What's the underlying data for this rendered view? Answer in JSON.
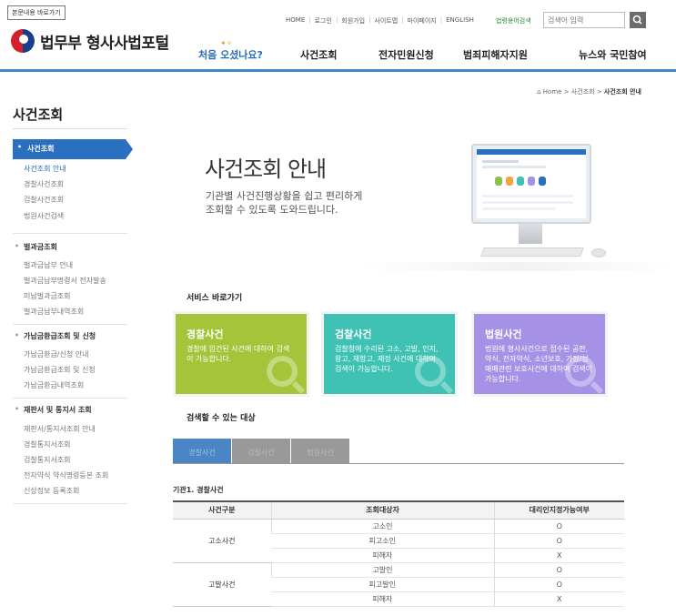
{
  "header": {
    "skip_link": "본문내용 바로가기",
    "utils": [
      "HOME",
      "로그인",
      "회원가입",
      "사이트맵",
      "마이페이지",
      "ENGLISH"
    ],
    "legal_terms": "법령용어검색",
    "search_placeholder": "검색어 입력",
    "logo_text": "법무부 형사사법포털"
  },
  "gnb": {
    "first": "처음 오셨나요?",
    "items": [
      "사건조회",
      "전자민원신청",
      "범죄피해자지원",
      "뉴스와 국민참여"
    ]
  },
  "breadcrumb": {
    "home": "Home",
    "mid": "사건조회",
    "current": "사건조회 안내",
    "sep": ">"
  },
  "sidebar": {
    "title": "사건조회",
    "groups": [
      {
        "label": "사건조회",
        "items": [
          "사건조회 안내",
          "경찰사건조회",
          "검찰사건조회",
          "법원사건검색"
        ]
      },
      {
        "label": "벌과금조회",
        "items": [
          "벌과금납부 안내",
          "벌과금납부명령서 전자발송",
          "미납벌과금조회",
          "벌과금납부내역조회"
        ]
      },
      {
        "label": "가납금환급조회 및 신청",
        "items": [
          "가납금환급/신청 안내",
          "가납금환급조회 및 신청",
          "가납금환급내역조회"
        ]
      },
      {
        "label": "재판서 및 통지서 조회",
        "items": [
          "재판서/통지서조회 안내",
          "경찰통지서조회",
          "검찰통지서조회",
          "전자약식 약식명령등본 조회",
          "신상정보 등록조회"
        ]
      }
    ]
  },
  "hero": {
    "title": "사건조회 안내",
    "desc_line1": "기관별 사건진행상황을 쉽고 편리하게",
    "desc_line2": "조회할 수 있도록 도와드립니다."
  },
  "services": {
    "title": "서비스 바로가기",
    "cards": [
      {
        "title": "경찰사건",
        "desc": "경찰에 입건된 사건에 대하여 검색이 가능합니다.",
        "color": "#a6c43a"
      },
      {
        "title": "검찰사건",
        "desc": "검찰청에 수리된 고소, 고발, 인지, 왕고, 재항고, 재정 사건에 대하여 검색이 가능합니다.",
        "color": "#3fc2b3"
      },
      {
        "title": "법원사건",
        "desc": "법원에 형사사건으로 접수된 공판, 약식, 전자약식, 소년보호, 가정/성매매관련 보호사건에 대하여 검색이 가능합니다.",
        "color": "#a592e6"
      }
    ]
  },
  "targets": {
    "title": "검색할 수 있는 대상",
    "tabs": [
      "경찰사건",
      "검찰사건",
      "법원사건"
    ],
    "active_tab": 0,
    "institution_label": "기관1. 경찰사건",
    "table": {
      "headers": [
        "사건구분",
        "조회대상자",
        "대리인지정가능여부"
      ],
      "groups": [
        {
          "name": "고소사건",
          "rows": [
            [
              "고소인",
              "O"
            ],
            [
              "피고소인",
              "O"
            ],
            [
              "피해자",
              "X"
            ]
          ]
        },
        {
          "name": "고발사건",
          "rows": [
            [
              "고발인",
              "O"
            ],
            [
              "피고발인",
              "O"
            ],
            [
              "피해자",
              "X"
            ]
          ]
        }
      ]
    }
  },
  "colors": {
    "accent": "#2b6fbf",
    "nav_line": "#3f88c8"
  }
}
